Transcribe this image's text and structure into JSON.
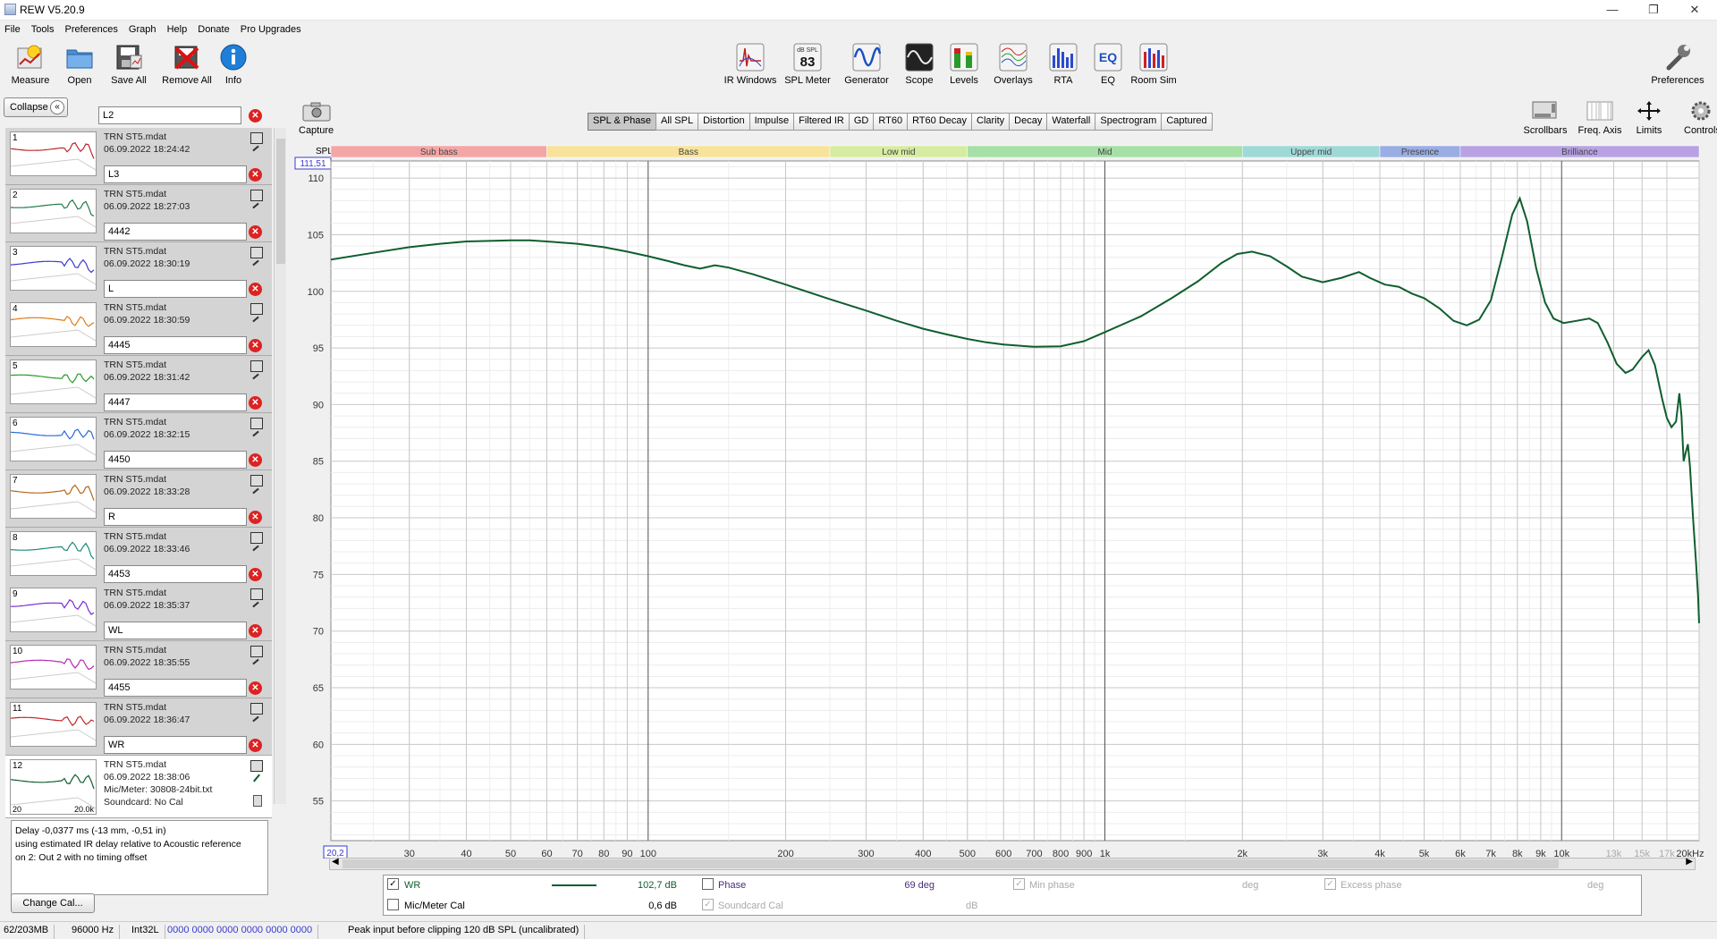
{
  "window": {
    "title": "REW V5.20.9"
  },
  "menu": [
    "File",
    "Tools",
    "Preferences",
    "Graph",
    "Help",
    "Donate",
    "Pro Upgrades"
  ],
  "toolbar_left": [
    {
      "label": "Measure",
      "icon": "measure-icon"
    },
    {
      "label": "Open",
      "icon": "folder-icon"
    },
    {
      "label": "Save All",
      "icon": "save-all-icon"
    },
    {
      "label": "Remove All",
      "icon": "remove-all-icon"
    },
    {
      "label": "Info",
      "icon": "info-icon"
    }
  ],
  "toolbar_center": [
    {
      "label": "IR Windows",
      "icon": "ir-windows-icon"
    },
    {
      "label": "SPL Meter",
      "icon": "spl-meter-icon",
      "value": "83",
      "unit": "dB SPL"
    },
    {
      "label": "Generator",
      "icon": "generator-icon"
    },
    {
      "label": "Scope",
      "icon": "scope-icon"
    },
    {
      "label": "Levels",
      "icon": "levels-icon"
    },
    {
      "label": "Overlays",
      "icon": "overlays-icon"
    },
    {
      "label": "RTA",
      "icon": "rta-icon"
    },
    {
      "label": "EQ",
      "icon": "eq-icon"
    },
    {
      "label": "Room Sim",
      "icon": "room-sim-icon"
    }
  ],
  "toolbar_right": {
    "label": "Preferences",
    "icon": "wrench-icon"
  },
  "panel": {
    "collapse_label": "Collapse",
    "top_name": "L2",
    "measurements": [
      {
        "num": "1",
        "file": "TRN ST5.mdat",
        "date": "06.09.2022 18:24:42",
        "name": "L3",
        "color": "#c0262a"
      },
      {
        "num": "2",
        "file": "TRN ST5.mdat",
        "date": "06.09.2022 18:27:03",
        "name": "4442",
        "color": "#1f7a4a"
      },
      {
        "num": "3",
        "file": "TRN ST5.mdat",
        "date": "06.09.2022 18:30:19",
        "name": "L",
        "color": "#3b3bd4"
      },
      {
        "num": "4",
        "file": "TRN ST5.mdat",
        "date": "06.09.2022 18:30:59",
        "name": "4445",
        "color": "#e07a1a"
      },
      {
        "num": "5",
        "file": "TRN ST5.mdat",
        "date": "06.09.2022 18:31:42",
        "name": "4447",
        "color": "#2a9a2a"
      },
      {
        "num": "6",
        "file": "TRN ST5.mdat",
        "date": "06.09.2022 18:32:15",
        "name": "4450",
        "color": "#2a6ad4"
      },
      {
        "num": "7",
        "file": "TRN ST5.mdat",
        "date": "06.09.2022 18:33:28",
        "name": "R",
        "color": "#b8661a"
      },
      {
        "num": "8",
        "file": "TRN ST5.mdat",
        "date": "06.09.2022 18:33:46",
        "name": "4453",
        "color": "#1a8a7a"
      },
      {
        "num": "9",
        "file": "TRN ST5.mdat",
        "date": "06.09.2022 18:35:37",
        "name": "WL",
        "color": "#7a2ad4"
      },
      {
        "num": "10",
        "file": "TRN ST5.mdat",
        "date": "06.09.2022 18:35:55",
        "name": "4455",
        "color": "#b42ab4"
      },
      {
        "num": "11",
        "file": "TRN ST5.mdat",
        "date": "06.09.2022 18:36:47",
        "name": "WR",
        "color": "#c0262a"
      }
    ],
    "selected": {
      "num": "12",
      "file": "TRN ST5.mdat",
      "date": "06.09.2022 18:38:06",
      "mic": "Mic/Meter: 30808-24bit.txt",
      "soundcard": "Soundcard: No Cal",
      "thumb_left": "20",
      "thumb_right": "20.0k",
      "color": "#0f5e2e"
    },
    "delay_text": [
      "Delay -0,0377 ms (-13 mm, -0,51 in)",
      "using estimated IR delay relative to Acoustic reference",
      "on 2: Out 2 with no timing offset"
    ],
    "change_cal": "Change Cal..."
  },
  "capture_label": "Capture",
  "graph_tabs": [
    "SPL & Phase",
    "All SPL",
    "Distortion",
    "Impulse",
    "Filtered IR",
    "GD",
    "RT60",
    "RT60 Decay",
    "Clarity",
    "Decay",
    "Waterfall",
    "Spectrogram",
    "Captured"
  ],
  "active_tab": "SPL & Phase",
  "graph_tools": [
    {
      "label": "Scrollbars",
      "icon": "scrollbars-icon"
    },
    {
      "label": "Freq. Axis",
      "icon": "freq-axis-icon"
    },
    {
      "label": "Limits",
      "icon": "limits-icon"
    },
    {
      "label": "Controls",
      "icon": "controls-icon"
    }
  ],
  "chart_data": {
    "type": "line",
    "ylabel": "SPL",
    "ylabel_top_value": "111,51",
    "x_start_label": "20,2",
    "x_scale": "log",
    "xlim": [
      20.2,
      20000
    ],
    "ylim": [
      51.5,
      111.51
    ],
    "y_ticks": [
      55,
      60,
      65,
      70,
      75,
      80,
      85,
      90,
      95,
      100,
      105,
      110
    ],
    "x_ticks": [
      {
        "v": 30,
        "l": "30"
      },
      {
        "v": 40,
        "l": "40"
      },
      {
        "v": 50,
        "l": "50"
      },
      {
        "v": 60,
        "l": "60"
      },
      {
        "v": 70,
        "l": "70"
      },
      {
        "v": 80,
        "l": "80"
      },
      {
        "v": 90,
        "l": "90"
      },
      {
        "v": 100,
        "l": "100"
      },
      {
        "v": 200,
        "l": "200"
      },
      {
        "v": 300,
        "l": "300"
      },
      {
        "v": 400,
        "l": "400"
      },
      {
        "v": 500,
        "l": "500"
      },
      {
        "v": 600,
        "l": "600"
      },
      {
        "v": 700,
        "l": "700"
      },
      {
        "v": 800,
        "l": "800"
      },
      {
        "v": 900,
        "l": "900"
      },
      {
        "v": 1000,
        "l": "1k"
      },
      {
        "v": 2000,
        "l": "2k"
      },
      {
        "v": 3000,
        "l": "3k"
      },
      {
        "v": 4000,
        "l": "4k"
      },
      {
        "v": 5000,
        "l": "5k"
      },
      {
        "v": 6000,
        "l": "6k"
      },
      {
        "v": 7000,
        "l": "7k"
      },
      {
        "v": 8000,
        "l": "8k"
      },
      {
        "v": 9000,
        "l": "9k"
      },
      {
        "v": 10000,
        "l": "10k"
      },
      {
        "v": 13000,
        "l": "13k",
        "dim": true
      },
      {
        "v": 15000,
        "l": "15k",
        "dim": true
      },
      {
        "v": 17000,
        "l": "17k",
        "dim": true
      },
      {
        "v": 20000,
        "l": "20kHz"
      }
    ],
    "bands": [
      {
        "label": "Sub bass",
        "from": 20.2,
        "to": 60,
        "color": "#f4a6a6"
      },
      {
        "label": "Bass",
        "from": 60,
        "to": 250,
        "color": "#f7e39a"
      },
      {
        "label": "Low mid",
        "from": 250,
        "to": 500,
        "color": "#d6eca0"
      },
      {
        "label": "Mid",
        "from": 500,
        "to": 2000,
        "color": "#a6e0a6"
      },
      {
        "label": "Upper mid",
        "from": 2000,
        "to": 4000,
        "color": "#9ed9d6"
      },
      {
        "label": "Presence",
        "from": 4000,
        "to": 6000,
        "color": "#9aaee4"
      },
      {
        "label": "Brilliance",
        "from": 6000,
        "to": 20000,
        "color": "#b8a2e4"
      }
    ],
    "series": [
      {
        "name": "WR",
        "color": "#0f5e2e",
        "points": [
          [
            20.2,
            102.8
          ],
          [
            25,
            103.4
          ],
          [
            30,
            103.9
          ],
          [
            35,
            104.2
          ],
          [
            40,
            104.4
          ],
          [
            45,
            104.45
          ],
          [
            50,
            104.5
          ],
          [
            55,
            104.5
          ],
          [
            60,
            104.4
          ],
          [
            70,
            104.2
          ],
          [
            80,
            103.9
          ],
          [
            90,
            103.5
          ],
          [
            100,
            103.1
          ],
          [
            110,
            102.7
          ],
          [
            120,
            102.3
          ],
          [
            130,
            102.0
          ],
          [
            140,
            102.3
          ],
          [
            150,
            102.1
          ],
          [
            170,
            101.5
          ],
          [
            200,
            100.6
          ],
          [
            250,
            99.3
          ],
          [
            300,
            98.3
          ],
          [
            350,
            97.4
          ],
          [
            400,
            96.7
          ],
          [
            450,
            96.2
          ],
          [
            500,
            95.8
          ],
          [
            550,
            95.5
          ],
          [
            600,
            95.3
          ],
          [
            700,
            95.1
          ],
          [
            800,
            95.15
          ],
          [
            900,
            95.6
          ],
          [
            1000,
            96.4
          ],
          [
            1200,
            97.8
          ],
          [
            1400,
            99.4
          ],
          [
            1600,
            100.9
          ],
          [
            1800,
            102.5
          ],
          [
            1950,
            103.3
          ],
          [
            2100,
            103.5
          ],
          [
            2300,
            103.1
          ],
          [
            2500,
            102.2
          ],
          [
            2700,
            101.3
          ],
          [
            3000,
            100.8
          ],
          [
            3300,
            101.2
          ],
          [
            3600,
            101.7
          ],
          [
            3800,
            101.2
          ],
          [
            4100,
            100.6
          ],
          [
            4400,
            100.4
          ],
          [
            4700,
            99.8
          ],
          [
            5000,
            99.4
          ],
          [
            5400,
            98.5
          ],
          [
            5800,
            97.4
          ],
          [
            6200,
            97.0
          ],
          [
            6600,
            97.5
          ],
          [
            7000,
            99.2
          ],
          [
            7400,
            103.0
          ],
          [
            7800,
            106.8
          ],
          [
            8100,
            108.2
          ],
          [
            8400,
            106.2
          ],
          [
            8800,
            102.0
          ],
          [
            9200,
            99.0
          ],
          [
            9600,
            97.6
          ],
          [
            10100,
            97.2
          ],
          [
            10800,
            97.4
          ],
          [
            11500,
            97.6
          ],
          [
            12000,
            97.2
          ],
          [
            12600,
            95.5
          ],
          [
            13200,
            93.6
          ],
          [
            13800,
            92.8
          ],
          [
            14300,
            93.1
          ],
          [
            15000,
            94.2
          ],
          [
            15500,
            94.8
          ],
          [
            16000,
            93.5
          ],
          [
            16600,
            90.5
          ],
          [
            17000,
            88.8
          ],
          [
            17400,
            88.0
          ],
          [
            17800,
            88.5
          ],
          [
            18100,
            91.0
          ],
          [
            18300,
            89.0
          ],
          [
            18500,
            85.0
          ],
          [
            18700,
            85.8
          ],
          [
            18900,
            86.5
          ],
          [
            19100,
            84.5
          ],
          [
            19400,
            80.0
          ],
          [
            19700,
            76.0
          ],
          [
            19900,
            73.0
          ],
          [
            20000,
            70.7
          ]
        ]
      }
    ]
  },
  "legend": {
    "wr": {
      "label": "WR",
      "value": "102,7 dB",
      "checked": true
    },
    "phase": {
      "label": "Phase",
      "value": "69 deg"
    },
    "min_phase": {
      "label": "Min phase",
      "unit": "deg"
    },
    "excess_phase": {
      "label": "Excess phase",
      "unit": "deg"
    },
    "mic_cal": {
      "label": "Mic/Meter Cal",
      "value": "0,6 dB"
    },
    "soundcard_cal": {
      "label": "Soundcard Cal",
      "unit": "dB"
    }
  },
  "status": {
    "memory": "62/203MB",
    "rate": "96000 Hz",
    "format": "Int32L",
    "bits": "0000 0000  0000 0000  0000 0000",
    "message": "Peak input before clipping 120 dB SPL (uncalibrated)"
  }
}
